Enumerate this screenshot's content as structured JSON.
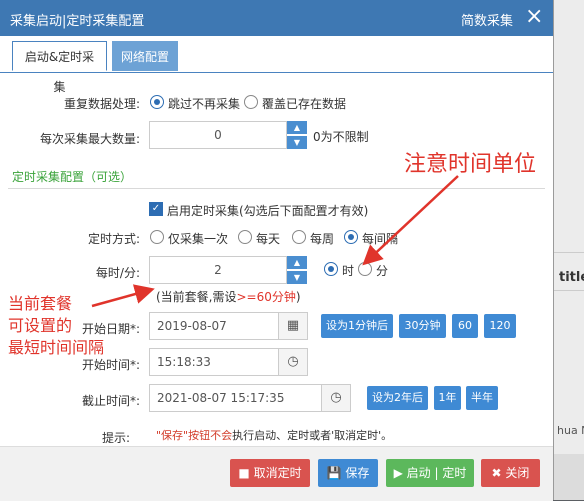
{
  "window": {
    "title": "采集启动|定时采集配置",
    "right_title": "简数采集",
    "close_icon": "×"
  },
  "tabs": [
    {
      "label": "启动&定时采集"
    },
    {
      "label": "网络配置"
    }
  ],
  "form": {
    "dup_label": "重复数据处理:",
    "dup_opt1": "跳过不再采集",
    "dup_opt2": "覆盖已存在数据",
    "max_label": "每次采集最大数量:",
    "max_value": "0",
    "max_hint": "0为不限制",
    "section_title": "定时采集配置（可选）",
    "enable_label": "启用定时采集(勾选后下面配置才有效)",
    "mode_label": "定时方式:",
    "mode_opts": [
      "仅采集一次",
      "每天",
      "每周",
      "每间隔"
    ],
    "interval_label": "每时/分:",
    "interval_value": "2",
    "unit_hour": "时",
    "unit_min": "分",
    "package_note_prefix": "(当前套餐,需设",
    "package_note_red": ">=60分钟",
    "package_note_suffix": ")",
    "start_date_label": "开始日期*:",
    "start_date_value": "2019-08-07",
    "start_time_label": "开始时间*:",
    "start_time_value": "15:18:33",
    "end_time_label": "截止时间*:",
    "end_time_value": "2021-08-07 15:17:35",
    "btn_1min": "设为1分钟后",
    "btn_30": "30分钟",
    "btn_60": "60",
    "btn_120": "120",
    "btn_2y": "设为2年后",
    "btn_1y": "1年",
    "btn_half": "半年",
    "tip_label": "提示:",
    "tip_red": "\"保存\"按钮不会",
    "tip_text": "执行启动、定时或者'取消定时'。"
  },
  "footer": {
    "cancel": "取消定时",
    "save": "保存",
    "start": "启动 | 定时",
    "close": "关闭"
  },
  "background": {
    "title": "title",
    "hua": "hua Nu"
  },
  "annotations": {
    "note_time_unit": "注意时间单位",
    "note_left_1": "当前套餐",
    "note_left_2": "可设置的",
    "note_left_3": "最短时间间隔"
  },
  "colors": {
    "header": "#3e78b3",
    "accent": "#3f8ad4",
    "annotation": "#e0342b",
    "section": "#3aa33a"
  }
}
